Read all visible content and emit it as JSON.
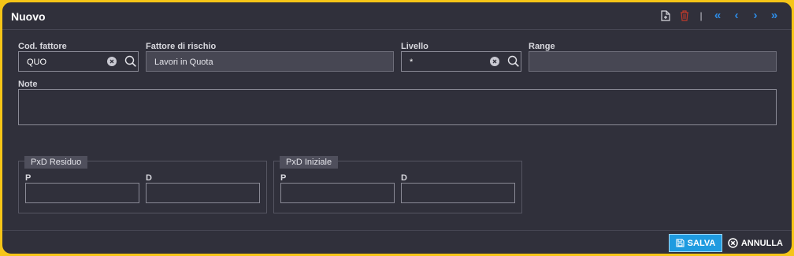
{
  "header": {
    "title": "Nuovo",
    "icons": [
      "new-document-icon",
      "trash-icon",
      "first-page-icon",
      "previous-icon",
      "next-icon",
      "last-page-icon"
    ],
    "separator": "|"
  },
  "form": {
    "cod_fattore": {
      "label": "Cod. fattore",
      "value": "QUO"
    },
    "fattore_rischio": {
      "label": "Fattore di rischio",
      "value": "Lavori in Quota"
    },
    "livello": {
      "label": "Livello",
      "value": "*"
    },
    "range": {
      "label": "Range",
      "value": ""
    },
    "note": {
      "label": "Note",
      "value": ""
    },
    "pxd_residuo": {
      "legend": "PxD Residuo",
      "p_label": "P",
      "d_label": "D",
      "p_value": "",
      "d_value": ""
    },
    "pxd_iniziale": {
      "legend": "PxD Iniziale",
      "p_label": "P",
      "d_label": "D",
      "p_value": "",
      "d_value": ""
    }
  },
  "footer": {
    "save_label": "SALVA",
    "cancel_label": "ANNULLA"
  },
  "colors": {
    "background": "#30303b",
    "border_accent": "#f5c518",
    "primary_button": "#1f9be0",
    "nav_arrows": "#2e8ce6",
    "delete_icon": "#c0392b"
  }
}
